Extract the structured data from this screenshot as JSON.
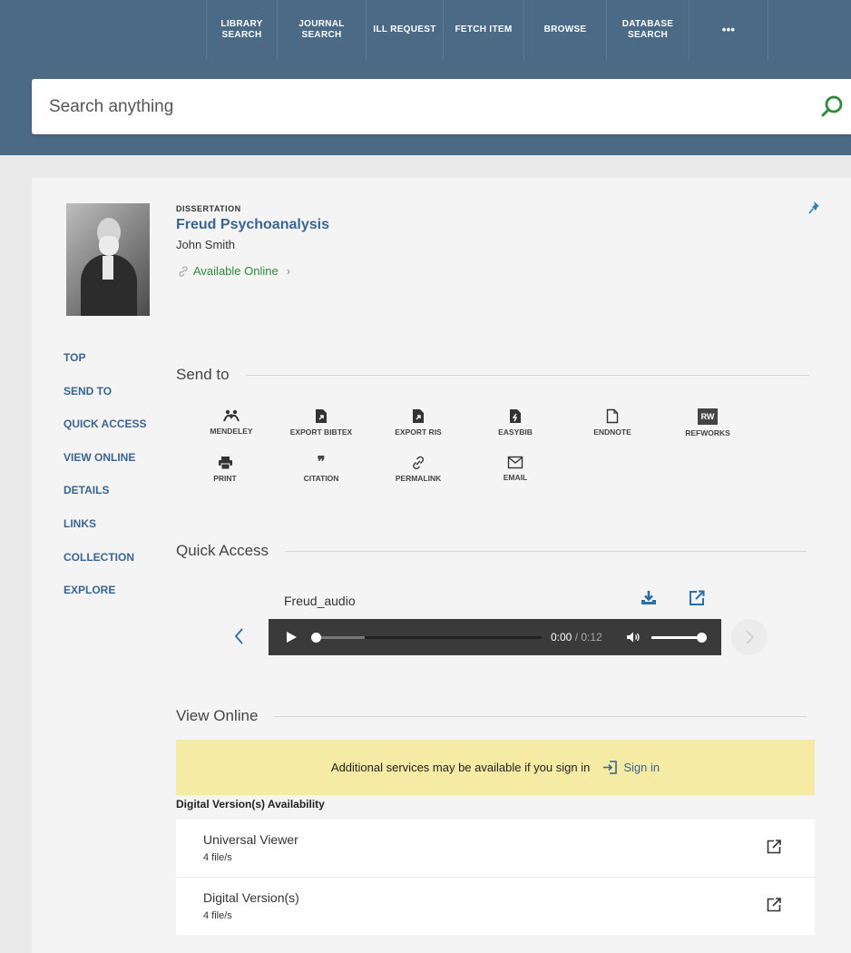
{
  "topnav": {
    "items": [
      {
        "line1": "LIBRARY",
        "line2": "SEARCH"
      },
      {
        "line1": "JOURNAL",
        "line2": "SEARCH"
      },
      {
        "line1": "ILL REQUEST",
        "line2": ""
      },
      {
        "line1": "FETCH ITEM",
        "line2": ""
      },
      {
        "line1": "BROWSE",
        "line2": ""
      },
      {
        "line1": "DATABASE",
        "line2": "SEARCH"
      },
      {
        "line1": "•••",
        "line2": ""
      }
    ]
  },
  "search": {
    "placeholder": "Search anything",
    "icon": "search-icon"
  },
  "record": {
    "type": "DISSERTATION",
    "title": "Freud Psychoanalysis",
    "author": "John Smith",
    "availability": "Available Online",
    "availability_chevron": "›",
    "colors": {
      "link": "#3a6591",
      "available": "#2e8b3e",
      "nav": "#4b6a86"
    }
  },
  "sidenav": [
    "TOP",
    "SEND TO",
    "QUICK ACCESS",
    "VIEW ONLINE",
    "DETAILS",
    "LINKS",
    "COLLECTION",
    "EXPLORE"
  ],
  "send_to": {
    "heading": "Send to",
    "actions": [
      "MENDELEY",
      "EXPORT BIBTEX",
      "EXPORT RIS",
      "EASYBIB",
      "ENDNOTE",
      "REFWORKS",
      "PRINT",
      "CITATION",
      "PERMALINK",
      "EMAIL"
    ],
    "refworks_badge": "RW",
    "citation_glyph": "❞"
  },
  "quick_access": {
    "heading": "Quick Access",
    "file_name": "Freud_audio",
    "player": {
      "current_time": "0:00",
      "separator": " / ",
      "duration": "0:12",
      "progress": 0.0,
      "buffered": 0.22,
      "volume": 1.0
    }
  },
  "view_online": {
    "heading": "View Online",
    "notice": "Additional services may be available if you sign in",
    "sign_in": "Sign in",
    "availability_heading": "Digital Version(s) Availability",
    "items": [
      {
        "name": "Universal Viewer",
        "count": "4 file/s"
      },
      {
        "name": "Digital Version(s)",
        "count": "4 file/s"
      }
    ]
  }
}
